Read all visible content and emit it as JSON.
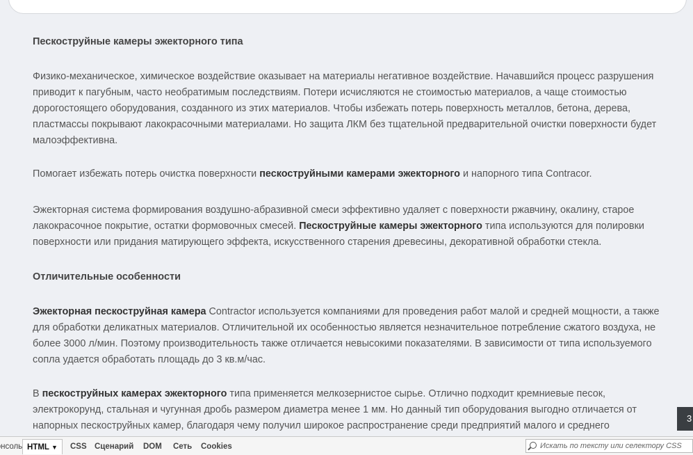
{
  "article": {
    "heading1": "Пескоструйные камеры эжекторного типа",
    "p1": "Физико-механическое, химическое воздействие оказывает на материалы негативное воздействие. Начавшийся процесс разрушения приводит к пагубным, часто необратимым последствиям. Потери исчисляются не стоимостью материалов, а чаще стоимостью дорогостоящего оборудования, созданного из этих материалов. Чтобы избежать потерь поверхность металлов, бетона, дерева, пластмассы покрывают лакокрасочными материалами. Но защита ЛКМ без тщательной предварительной очистки поверхности будет малоэффективна.",
    "p2": {
      "a": "Помогает избежать потерь очистка поверхности ",
      "b": "пескоструйными камерами эжекторного",
      "c": " и напорного типа Contracor."
    },
    "p3": {
      "a": "Эжекторная система формирования воздушно-абразивной смеси эффективно удаляет с поверхности ржавчину, окалину, старое лакокрасочное покрытие, остатки формовочных смесей. ",
      "b": "Пескоструйные камеры эжекторного",
      "c": " типа используются для полировки поверхности или придания матирующего эффекта, искусственного старения древесины, декоративной обработки стекла."
    },
    "heading2": "Отличительные особенности",
    "p4": {
      "b": "Эжекторная пескоструйная камера",
      "c": " Contractor используется компаниями для проведения работ малой и средней мощности, а также для обработки деликатных материалов. Отличительной их особенностью является незначительное потребление сжатого воздуха, не более 3000 л/мин. Поэтому производительность также отличается невысокими показателями. В зависимости от типа используемого сопла удается обработать площадь до 3 кв.м/час."
    },
    "p5": {
      "a": "В ",
      "b": "пескоструйных камерах эжекторного",
      "c": " типа применяется мелкозернистое сырье. Отлично подходит кремниевые песок, электрокорунд, стальная и чугунная дробь размером диаметра менее 1 мм. Но данный тип оборудования выгодно отличается от напорных пескоструйных камер, благодаря чему получил широкое распространение среди предприятий малого и среднего"
    }
  },
  "scroll_badge": "3",
  "devtools": {
    "tabs": {
      "console": "Консоль",
      "html": "HTML",
      "css": "CSS",
      "script": "Сценарий",
      "dom": "DOM",
      "net": "Сеть",
      "cookies": "Cookies"
    },
    "search_placeholder": "Искать по тексту или селектору CSS",
    "icons": {
      "search": "magnifier-icon",
      "dropdown": "triangle-down-icon"
    }
  }
}
